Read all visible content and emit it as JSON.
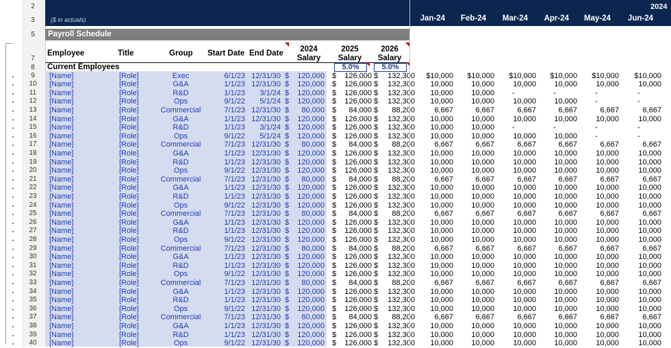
{
  "row_numbers_top": [
    "2",
    "3",
    "5",
    "7",
    "8"
  ],
  "unit_note": "($ in actuals)",
  "year_label": "2024",
  "months": [
    "Jan-24",
    "Feb-24",
    "Mar-24",
    "Apr-24",
    "May-24",
    "Jun-24"
  ],
  "section_title": "Payroll Schedule",
  "headers": {
    "employee": "Employee",
    "title": "Title",
    "group": "Group",
    "start_date": "Start Date",
    "end_date": "End Date",
    "sal24_a": "2024",
    "sal24_b": "Salary",
    "sal25_a": "2025",
    "sal25_b": "Salary",
    "sal26_a": "2026",
    "sal26_b": "Salary"
  },
  "current_label": "Current Employees",
  "growth_2025": "5.0%",
  "growth_2026": "5.0%",
  "rows": [
    {
      "n": "9",
      "name": "[Name]",
      "role": "[Role]",
      "group": "Exec",
      "start": "6/1/23",
      "end": "12/31/30",
      "s24": "120,000",
      "s25": "126,000",
      "s26": "132,300",
      "m": [
        "$10,000",
        "$10,000",
        "$10,000",
        "$10,000",
        "$10,000",
        "$10,000"
      ]
    },
    {
      "n": "10",
      "name": "[Name]",
      "role": "[Role]",
      "group": "G&A",
      "start": "1/1/23",
      "end": "12/31/30",
      "s24": "120,000",
      "s25": "126,000",
      "s26": "132,300",
      "m": [
        "10,000",
        "10,000",
        "10,000",
        "10,000",
        "10,000",
        "10,000"
      ]
    },
    {
      "n": "11",
      "name": "[Name]",
      "role": "[Role]",
      "group": "R&D",
      "start": "1/1/23",
      "end": "3/1/24",
      "s24": "120,000",
      "s25": "126,000",
      "s26": "132,300",
      "m": [
        "10,000",
        "10,000",
        "-",
        "-",
        "-",
        "-"
      ]
    },
    {
      "n": "12",
      "name": "[Name]",
      "role": "[Role]",
      "group": "Ops",
      "start": "9/1/22",
      "end": "5/1/24",
      "s24": "120,000",
      "s25": "126,000",
      "s26": "132,300",
      "m": [
        "10,000",
        "10,000",
        "10,000",
        "10,000",
        "-",
        "-"
      ]
    },
    {
      "n": "13",
      "name": "[Name]",
      "role": "[Role]",
      "group": "Commercial",
      "start": "7/1/23",
      "end": "12/31/30",
      "s24": "80,000",
      "s25": "84,000",
      "s26": "88,200",
      "m": [
        "6,667",
        "6,667",
        "6,667",
        "6,667",
        "6,667",
        "6,667"
      ]
    },
    {
      "n": "14",
      "name": "[Name]",
      "role": "[Role]",
      "group": "G&A",
      "start": "1/1/23",
      "end": "12/31/30",
      "s24": "120,000",
      "s25": "126,000",
      "s26": "132,300",
      "m": [
        "10,000",
        "10,000",
        "10,000",
        "10,000",
        "10,000",
        "10,000"
      ]
    },
    {
      "n": "15",
      "name": "[Name]",
      "role": "[Role]",
      "group": "R&D",
      "start": "1/1/23",
      "end": "3/1/24",
      "s24": "120,000",
      "s25": "126,000",
      "s26": "132,300",
      "m": [
        "10,000",
        "10,000",
        "-",
        "-",
        "-",
        "-"
      ]
    },
    {
      "n": "16",
      "name": "[Name]",
      "role": "[Role]",
      "group": "Ops",
      "start": "9/1/22",
      "end": "5/1/24",
      "s24": "120,000",
      "s25": "126,000",
      "s26": "132,300",
      "m": [
        "10,000",
        "10,000",
        "10,000",
        "10,000",
        "-",
        "-"
      ]
    },
    {
      "n": "17",
      "name": "[Name]",
      "role": "[Role]",
      "group": "Commercial",
      "start": "7/1/23",
      "end": "12/31/30",
      "s24": "80,000",
      "s25": "84,000",
      "s26": "88,200",
      "m": [
        "6,667",
        "6,667",
        "6,667",
        "6,667",
        "6,667",
        "6,667"
      ]
    },
    {
      "n": "18",
      "name": "[Name]",
      "role": "[Role]",
      "group": "G&A",
      "start": "1/1/23",
      "end": "12/31/30",
      "s24": "120,000",
      "s25": "126,000",
      "s26": "132,300",
      "m": [
        "10,000",
        "10,000",
        "10,000",
        "10,000",
        "10,000",
        "10,000"
      ]
    },
    {
      "n": "19",
      "name": "[Name]",
      "role": "[Role]",
      "group": "R&D",
      "start": "1/1/23",
      "end": "12/31/30",
      "s24": "120,000",
      "s25": "126,000",
      "s26": "132,300",
      "m": [
        "10,000",
        "10,000",
        "10,000",
        "10,000",
        "10,000",
        "10,000"
      ]
    },
    {
      "n": "20",
      "name": "[Name]",
      "role": "[Role]",
      "group": "Ops",
      "start": "9/1/22",
      "end": "12/31/30",
      "s24": "120,000",
      "s25": "126,000",
      "s26": "132,300",
      "m": [
        "10,000",
        "10,000",
        "10,000",
        "10,000",
        "10,000",
        "10,000"
      ]
    },
    {
      "n": "21",
      "name": "[Name]",
      "role": "[Role]",
      "group": "Commercial",
      "start": "7/1/23",
      "end": "12/31/30",
      "s24": "80,000",
      "s25": "84,000",
      "s26": "88,200",
      "m": [
        "6,667",
        "6,667",
        "6,667",
        "6,667",
        "6,667",
        "6,667"
      ]
    },
    {
      "n": "22",
      "name": "[Name]",
      "role": "[Role]",
      "group": "G&A",
      "start": "1/1/23",
      "end": "12/31/30",
      "s24": "120,000",
      "s25": "126,000",
      "s26": "132,300",
      "m": [
        "10,000",
        "10,000",
        "10,000",
        "10,000",
        "10,000",
        "10,000"
      ]
    },
    {
      "n": "23",
      "name": "[Name]",
      "role": "[Role]",
      "group": "R&D",
      "start": "1/1/23",
      "end": "12/31/30",
      "s24": "120,000",
      "s25": "126,000",
      "s26": "132,300",
      "m": [
        "10,000",
        "10,000",
        "10,000",
        "10,000",
        "10,000",
        "10,000"
      ]
    },
    {
      "n": "24",
      "name": "[Name]",
      "role": "[Role]",
      "group": "Ops",
      "start": "9/1/22",
      "end": "12/31/30",
      "s24": "120,000",
      "s25": "126,000",
      "s26": "132,300",
      "m": [
        "10,000",
        "10,000",
        "10,000",
        "10,000",
        "10,000",
        "10,000"
      ]
    },
    {
      "n": "25",
      "name": "[Name]",
      "role": "[Role]",
      "group": "Commercial",
      "start": "7/1/23",
      "end": "12/31/30",
      "s24": "80,000",
      "s25": "84,000",
      "s26": "88,200",
      "m": [
        "6,667",
        "6,667",
        "6,667",
        "6,667",
        "6,667",
        "6,667"
      ]
    },
    {
      "n": "26",
      "name": "[Name]",
      "role": "[Role]",
      "group": "G&A",
      "start": "1/1/23",
      "end": "12/31/30",
      "s24": "120,000",
      "s25": "126,000",
      "s26": "132,300",
      "m": [
        "10,000",
        "10,000",
        "10,000",
        "10,000",
        "10,000",
        "10,000"
      ]
    },
    {
      "n": "27",
      "name": "[Name]",
      "role": "[Role]",
      "group": "R&D",
      "start": "1/1/23",
      "end": "12/31/30",
      "s24": "120,000",
      "s25": "126,000",
      "s26": "132,300",
      "m": [
        "10,000",
        "10,000",
        "10,000",
        "10,000",
        "10,000",
        "10,000"
      ]
    },
    {
      "n": "28",
      "name": "[Name]",
      "role": "[Role]",
      "group": "Ops",
      "start": "9/1/22",
      "end": "12/31/30",
      "s24": "120,000",
      "s25": "126,000",
      "s26": "132,300",
      "m": [
        "10,000",
        "10,000",
        "10,000",
        "10,000",
        "10,000",
        "10,000"
      ]
    },
    {
      "n": "29",
      "name": "[Name]",
      "role": "[Role]",
      "group": "Commercial",
      "start": "7/1/23",
      "end": "12/31/30",
      "s24": "80,000",
      "s25": "84,000",
      "s26": "88,200",
      "m": [
        "6,667",
        "6,667",
        "6,667",
        "6,667",
        "6,667",
        "6,667"
      ]
    },
    {
      "n": "30",
      "name": "[Name]",
      "role": "[Role]",
      "group": "G&A",
      "start": "1/1/23",
      "end": "12/31/30",
      "s24": "120,000",
      "s25": "126,000",
      "s26": "132,300",
      "m": [
        "10,000",
        "10,000",
        "10,000",
        "10,000",
        "10,000",
        "10,000"
      ]
    },
    {
      "n": "31",
      "name": "[Name]",
      "role": "[Role]",
      "group": "R&D",
      "start": "1/1/23",
      "end": "12/31/30",
      "s24": "120,000",
      "s25": "126,000",
      "s26": "132,300",
      "m": [
        "10,000",
        "10,000",
        "10,000",
        "10,000",
        "10,000",
        "10,000"
      ]
    },
    {
      "n": "32",
      "name": "[Name]",
      "role": "[Role]",
      "group": "Ops",
      "start": "9/1/22",
      "end": "12/31/30",
      "s24": "120,000",
      "s25": "126,000",
      "s26": "132,300",
      "m": [
        "10,000",
        "10,000",
        "10,000",
        "10,000",
        "10,000",
        "10,000"
      ]
    },
    {
      "n": "33",
      "name": "[Name]",
      "role": "[Role]",
      "group": "Commercial",
      "start": "7/1/23",
      "end": "12/31/30",
      "s24": "80,000",
      "s25": "84,000",
      "s26": "88,200",
      "m": [
        "6,667",
        "6,667",
        "6,667",
        "6,667",
        "6,667",
        "6,667"
      ]
    },
    {
      "n": "34",
      "name": "[Name]",
      "role": "[Role]",
      "group": "G&A",
      "start": "1/1/23",
      "end": "12/31/30",
      "s24": "120,000",
      "s25": "126,000",
      "s26": "132,300",
      "m": [
        "10,000",
        "10,000",
        "10,000",
        "10,000",
        "10,000",
        "10,000"
      ]
    },
    {
      "n": "35",
      "name": "[Name]",
      "role": "[Role]",
      "group": "R&D",
      "start": "1/1/23",
      "end": "12/31/30",
      "s24": "120,000",
      "s25": "126,000",
      "s26": "132,300",
      "m": [
        "10,000",
        "10,000",
        "10,000",
        "10,000",
        "10,000",
        "10,000"
      ]
    },
    {
      "n": "36",
      "name": "[Name]",
      "role": "[Role]",
      "group": "Ops",
      "start": "9/1/22",
      "end": "12/31/30",
      "s24": "120,000",
      "s25": "126,000",
      "s26": "132,300",
      "m": [
        "10,000",
        "10,000",
        "10,000",
        "10,000",
        "10,000",
        "10,000"
      ]
    },
    {
      "n": "37",
      "name": "[Name]",
      "role": "[Role]",
      "group": "Commercial",
      "start": "7/1/23",
      "end": "12/31/30",
      "s24": "80,000",
      "s25": "84,000",
      "s26": "88,200",
      "m": [
        "6,667",
        "6,667",
        "6,667",
        "6,667",
        "6,667",
        "6,667"
      ]
    },
    {
      "n": "38",
      "name": "[Name]",
      "role": "[Role]",
      "group": "G&A",
      "start": "1/1/23",
      "end": "12/31/30",
      "s24": "120,000",
      "s25": "126,000",
      "s26": "132,300",
      "m": [
        "10,000",
        "10,000",
        "10,000",
        "10,000",
        "10,000",
        "10,000"
      ]
    },
    {
      "n": "39",
      "name": "[Name]",
      "role": "[Role]",
      "group": "R&D",
      "start": "1/1/23",
      "end": "12/31/30",
      "s24": "120,000",
      "s25": "126,000",
      "s26": "132,300",
      "m": [
        "10,000",
        "10,000",
        "10,000",
        "10,000",
        "10,000",
        "10,000"
      ]
    },
    {
      "n": "40",
      "name": "[Name]",
      "role": "[Role]",
      "group": "Ops",
      "start": "9/1/22",
      "end": "12/31/30",
      "s24": "120,000",
      "s25": "126,000",
      "s26": "132,300",
      "m": [
        "10,000",
        "10,000",
        "10,000",
        "10,000",
        "10,000",
        "10,000"
      ]
    }
  ],
  "currency_symbol": "$",
  "colors": {
    "navy": "#0b2750",
    "section_gray": "#7f7f7f",
    "input_blue": "#1f3bb0",
    "input_fill": "#d6dcef",
    "flag_red": "#c00000"
  }
}
